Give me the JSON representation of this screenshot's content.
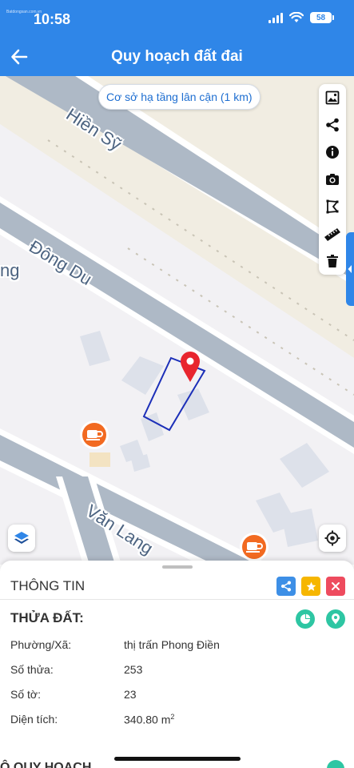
{
  "status_bar": {
    "time": "10:58",
    "carrier_text": "Batdongsan.com.vn",
    "battery": "58"
  },
  "header": {
    "title": "Quy hoạch đất đai",
    "back_icon": "arrow-left-icon"
  },
  "map": {
    "nearby_chip": "Cơ sở hạ tầng lân cận (1 km)",
    "streets": {
      "hien_sy": "Hiền Sỹ",
      "dong_du": "Đông Du",
      "van_lang": "Văn Lang",
      "partial": "ng"
    },
    "toolbar_icons": [
      "image-icon",
      "share-icon",
      "info-icon",
      "camera-icon",
      "polygon-icon",
      "ruler-icon",
      "trash-icon"
    ],
    "colors": {
      "road": "#aeb9c6",
      "road_edge": "#ffffff",
      "parcel_outline": "#1c2fb8",
      "pin": "#e8252e",
      "poi": "#f26a21",
      "building": "#dde1ea",
      "beige_zone": "#f1ede2"
    }
  },
  "panel": {
    "title": "THÔNG TIN",
    "section_title": "THỬA ĐẤT:",
    "rows": [
      {
        "label": "Phường/Xã:",
        "value": "thị trấn Phong Điền"
      },
      {
        "label": "Số thửa:",
        "value": "253"
      },
      {
        "label": "Số tờ:",
        "value": "23"
      },
      {
        "label": "Diện tích:",
        "value": "340.80 m",
        "unit_sup": "2"
      }
    ],
    "next_section_title": "Ô QUY HOẠCH",
    "action_colors": {
      "share": "#3d8fe6",
      "star": "#f6b600",
      "close": "#ee4b5e"
    }
  }
}
